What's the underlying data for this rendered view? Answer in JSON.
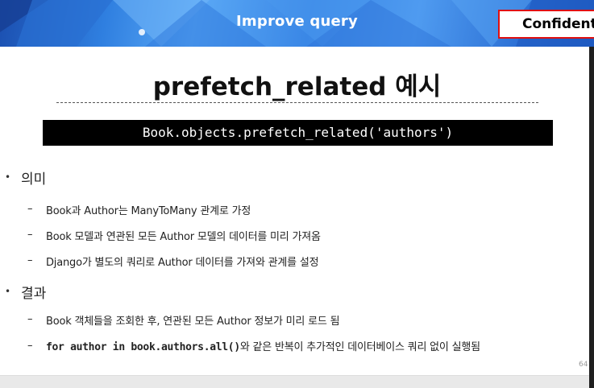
{
  "banner": {
    "title": "Improve query",
    "confidential": "Confidential"
  },
  "slide": {
    "title": "prefetch_related 예시",
    "code": "Book.objects.prefetch_related('authors')"
  },
  "sections": [
    {
      "heading": "의미",
      "items": [
        "Book과 Author는 ManyToMany 관계로 가정",
        "Book 모델과 연관된 모든 Author 모델의 데이터를 미리 가져옴",
        "Django가 별도의 쿼리로 Author 데이터를 가져와 관계를 설정"
      ]
    },
    {
      "heading": "결과",
      "items": [
        "Book 객체들을 조회한 후, 연관된 모든 Author 정보가 미리 로드 됨"
      ],
      "code_item": {
        "code": "for author in book.authors.all()",
        "text": "와 같은 반복이 추가적인 데이터베이스 쿼리 없이 실행됨"
      }
    }
  ],
  "page_number": "64",
  "symbols": {
    "bullet": "•",
    "dash": "–"
  },
  "colors": {
    "banner_blue": "#2f7fe0",
    "confidential_border": "#e01010",
    "code_bg": "#000000"
  }
}
